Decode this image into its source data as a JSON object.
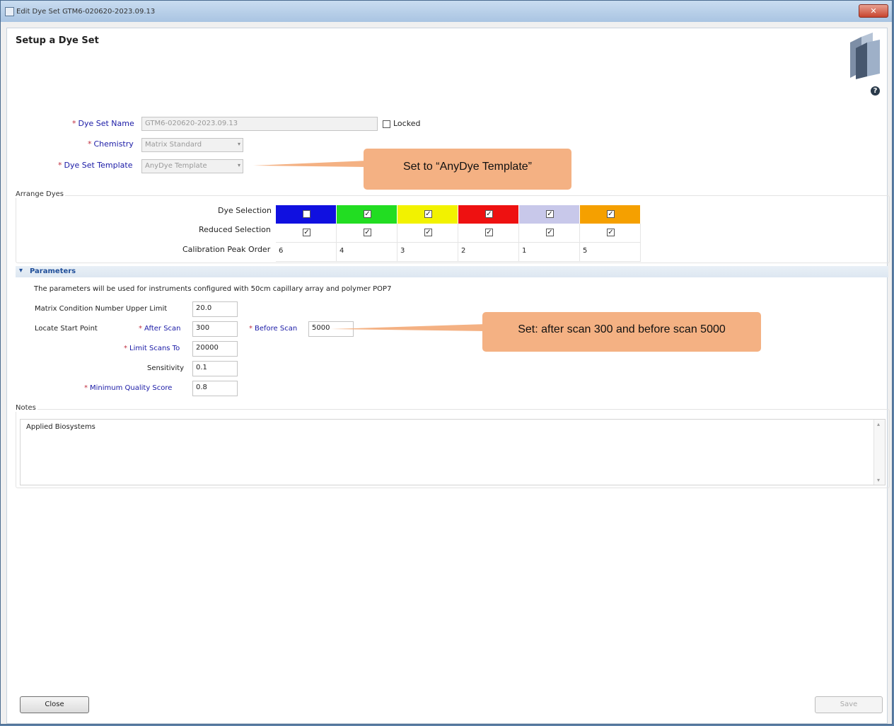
{
  "window": {
    "title": "Edit Dye Set GTM6-020620-2023.09.13",
    "close_glyph": "✕"
  },
  "page": {
    "title": "Setup a Dye Set",
    "help_glyph": "?"
  },
  "form": {
    "dye_set_name_label": "Dye Set Name",
    "dye_set_name_value": "GTM6-020620-2023.09.13",
    "locked_label": "Locked",
    "chemistry_label": "Chemistry",
    "chemistry_value": "Matrix Standard",
    "template_label": "Dye Set Template",
    "template_value": "AnyDye Template",
    "required_mark": "*"
  },
  "callouts": {
    "template": "Set to “AnyDye Template”",
    "scan": "Set: after scan 300 and before scan 5000"
  },
  "arrange_dyes": {
    "title": "Arrange Dyes",
    "row_labels": {
      "selection": "Dye Selection",
      "reduced": "Reduced Selection",
      "order": "Calibration Peak Order"
    },
    "dyes": [
      {
        "color": "#1010e0",
        "selected": false,
        "reduced": true,
        "order": "6"
      },
      {
        "color": "#22dd22",
        "selected": true,
        "reduced": true,
        "order": "4"
      },
      {
        "color": "#f2f200",
        "selected": true,
        "reduced": true,
        "order": "3"
      },
      {
        "color": "#ee1111",
        "selected": true,
        "reduced": true,
        "order": "2"
      },
      {
        "color": "#c8c8ea",
        "selected": true,
        "reduced": true,
        "order": "1"
      },
      {
        "color": "#f5a000",
        "selected": true,
        "reduced": true,
        "order": "5"
      }
    ]
  },
  "parameters": {
    "title": "Parameters",
    "description": "The parameters will be used for instruments configured with 50cm capillary array and polymer POP7",
    "matrix_label": "Matrix Condition Number Upper Limit",
    "matrix_value": "20.0",
    "locate_label": "Locate Start Point",
    "after_scan_label": "After Scan",
    "after_scan_value": "300",
    "before_scan_label": "Before Scan",
    "before_scan_value": "5000",
    "limit_label": "Limit Scans To",
    "limit_value": "20000",
    "sensitivity_label": "Sensitivity",
    "sensitivity_value": "0.1",
    "quality_label": "Minimum Quality Score",
    "quality_value": "0.8"
  },
  "notes": {
    "title": "Notes",
    "text": "Applied Biosystems"
  },
  "buttons": {
    "close": "Close",
    "save": "Save"
  },
  "icons": {
    "checkmark": "✓",
    "dropdown": "▾",
    "collapse": "▾",
    "scroll_up": "▴",
    "scroll_down": "▾"
  }
}
